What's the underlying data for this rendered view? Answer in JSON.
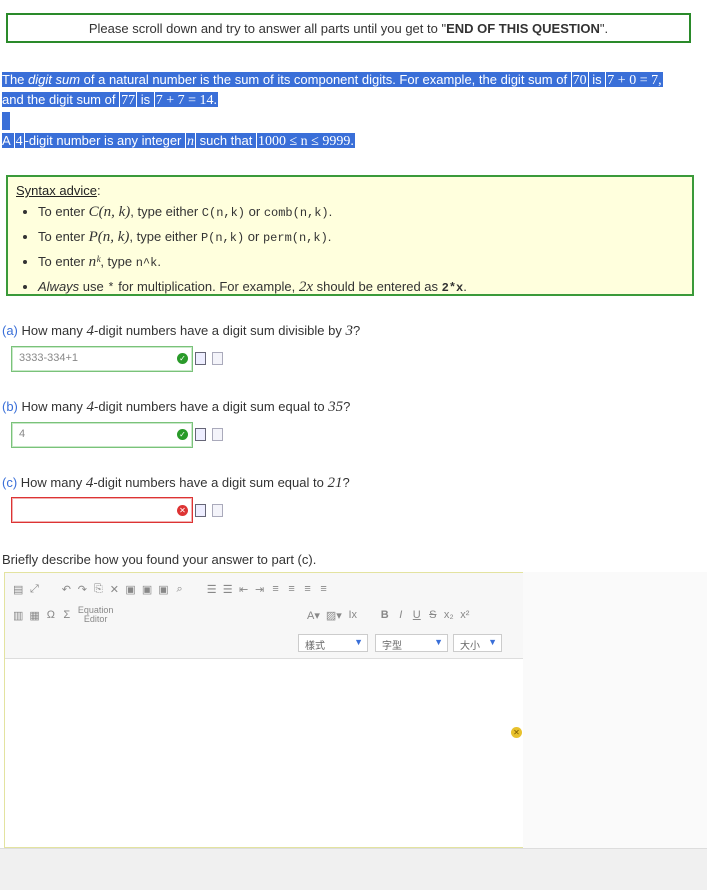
{
  "notice": {
    "text": "Please scroll down and try to answer all parts until you get to \"",
    "bold": "END OF THIS QUESTION",
    "end": "\"."
  },
  "intro": {
    "line1a": "The ",
    "line1b": "digit sum",
    "line1c": " of a natural number is the sum of its component digits. For example, the digit sum of ",
    "n70": "70",
    "is1": " is ",
    "ex1": "7 + 0 = 7,",
    "line2a": "and the digit sum of ",
    "n77": "77",
    "is2": " is ",
    "ex2": "7 + 7 = 14.",
    "line3a": "A ",
    "n4": "4",
    "line3b": "-digit number is any integer ",
    "nvar": "n",
    "line3c": " such that ",
    "ineq": "1000 ≤ n ≤ 9999."
  },
  "syntax": {
    "title": "Syntax advice",
    "colon": ":",
    "items": [
      {
        "pre": "To enter ",
        "math": "C(n, k)",
        "mid": ", type either ",
        "code1": "C(n,k)",
        "or": " or ",
        "code2": "comb(n,k)",
        "post": "."
      },
      {
        "pre": "To enter ",
        "math": "P(n, k)",
        "mid": ", type either ",
        "code1": "P(n,k)",
        "or": " or ",
        "code2": "perm(n,k)",
        "post": "."
      },
      {
        "pre": "To enter ",
        "math": "nᵏ",
        "mid": ", type ",
        "code1": "n^k",
        "post": "."
      },
      {
        "pre1": "Always",
        "pre2": " use ",
        "star": "*",
        "mid": " for multiplication. For example, ",
        "math": "2x",
        "mid2": " should be entered as ",
        "code1": "2*x",
        "post": "."
      }
    ]
  },
  "questions": [
    {
      "label": "(a)",
      "text1": " How many ",
      "num": "4",
      "text2": "-digit numbers have a digit sum divisible by ",
      "num2": "3",
      "text3": "?",
      "answer": "3333-334+1",
      "status": "correct"
    },
    {
      "label": "(b)",
      "text1": " How many ",
      "num": "4",
      "text2": "-digit numbers have a digit sum equal to ",
      "num2": "35",
      "text3": "?",
      "answer": "4",
      "status": "correct"
    },
    {
      "label": "(c)",
      "text1": " How many ",
      "num": "4",
      "text2": "-digit numbers have a digit sum equal to ",
      "num2": "21",
      "text3": "?",
      "answer": "",
      "status": "incorrect"
    }
  ],
  "describe_prompt": "Briefly describe how you found your answer to part (c).",
  "editor": {
    "equation_label_1": "Equation",
    "equation_label_2": "Editor",
    "style_combo": "樣式",
    "font_combo": "字型",
    "size_combo": "大小"
  }
}
